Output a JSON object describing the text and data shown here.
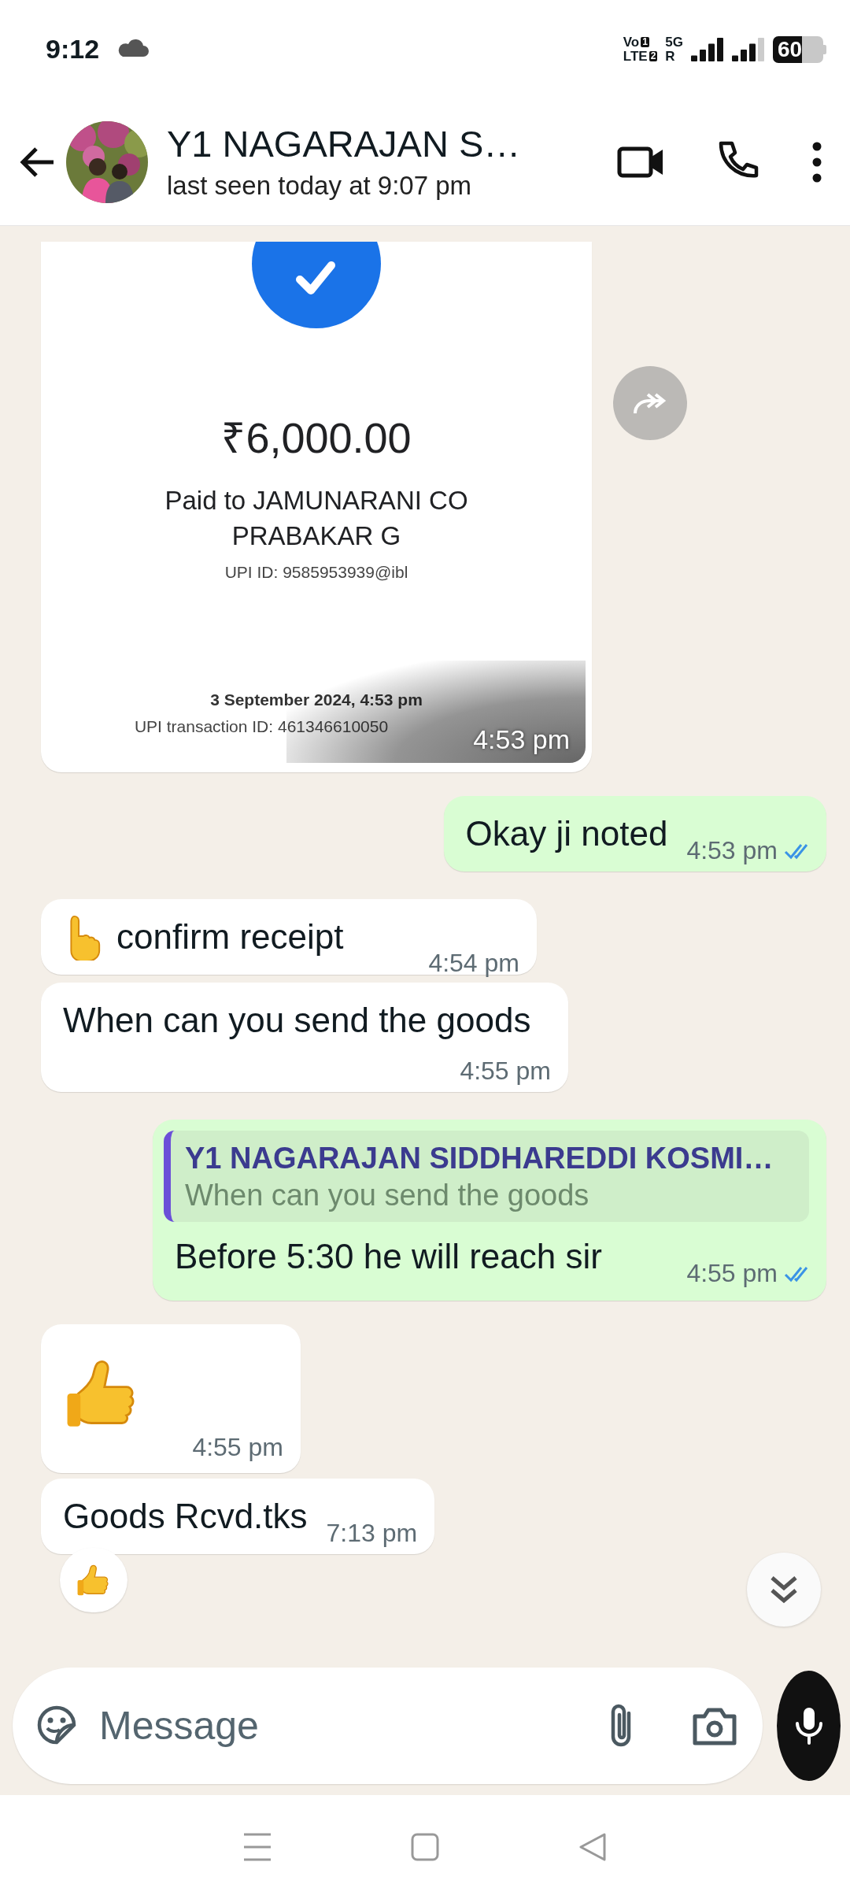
{
  "status_bar": {
    "time": "9:12",
    "network": [
      {
        "label": "Vo",
        "badge": "1"
      },
      {
        "label": "LTE",
        "badge": "2"
      }
    ],
    "data": [
      {
        "label": "5G"
      },
      {
        "label": "R"
      }
    ],
    "battery": "60"
  },
  "header": {
    "title": "Y1 NAGARAJAN S…",
    "subtitle": "last seen today at 9:07 pm"
  },
  "messages": [
    {
      "outgoing": false,
      "receipt": {
        "amount": "₹6,000.00",
        "payee": "Paid to JAMUNARANI CO PRABAKAR G",
        "upi_id": "UPI ID: 9585953939@ibl",
        "date": "3 September 2024, 4:53 pm",
        "transaction": "UPI transaction ID: 461346610050"
      },
      "time": "4:53 pm"
    },
    {
      "kind": "text",
      "outgoing": true,
      "text": "Okay ji noted",
      "time": "4:53 pm",
      "read": true
    },
    {
      "kind": "pointing",
      "outgoing": false,
      "text": "confirm receipt",
      "time": "4:54 pm"
    },
    {
      "kind": "text",
      "outgoing": false,
      "text": "When can you send the goods",
      "time": "4:55 pm"
    },
    {
      "kind": "reply",
      "outgoing": true,
      "quote_author": "Y1 NAGARAJAN SIDDHAREDDI KOSMI…",
      "quote_text": "When can you send the goods",
      "text": "Before 5:30 he will reach sir",
      "time": "4:55 pm",
      "read": true
    },
    {
      "kind": "thumbs",
      "outgoing": false,
      "time": "4:55 pm"
    },
    {
      "kind": "text",
      "outgoing": false,
      "text": "Goods Rcvd.tks",
      "time": "7:13 pm",
      "reaction": true
    }
  ],
  "composer": {
    "placeholder": "Message"
  }
}
